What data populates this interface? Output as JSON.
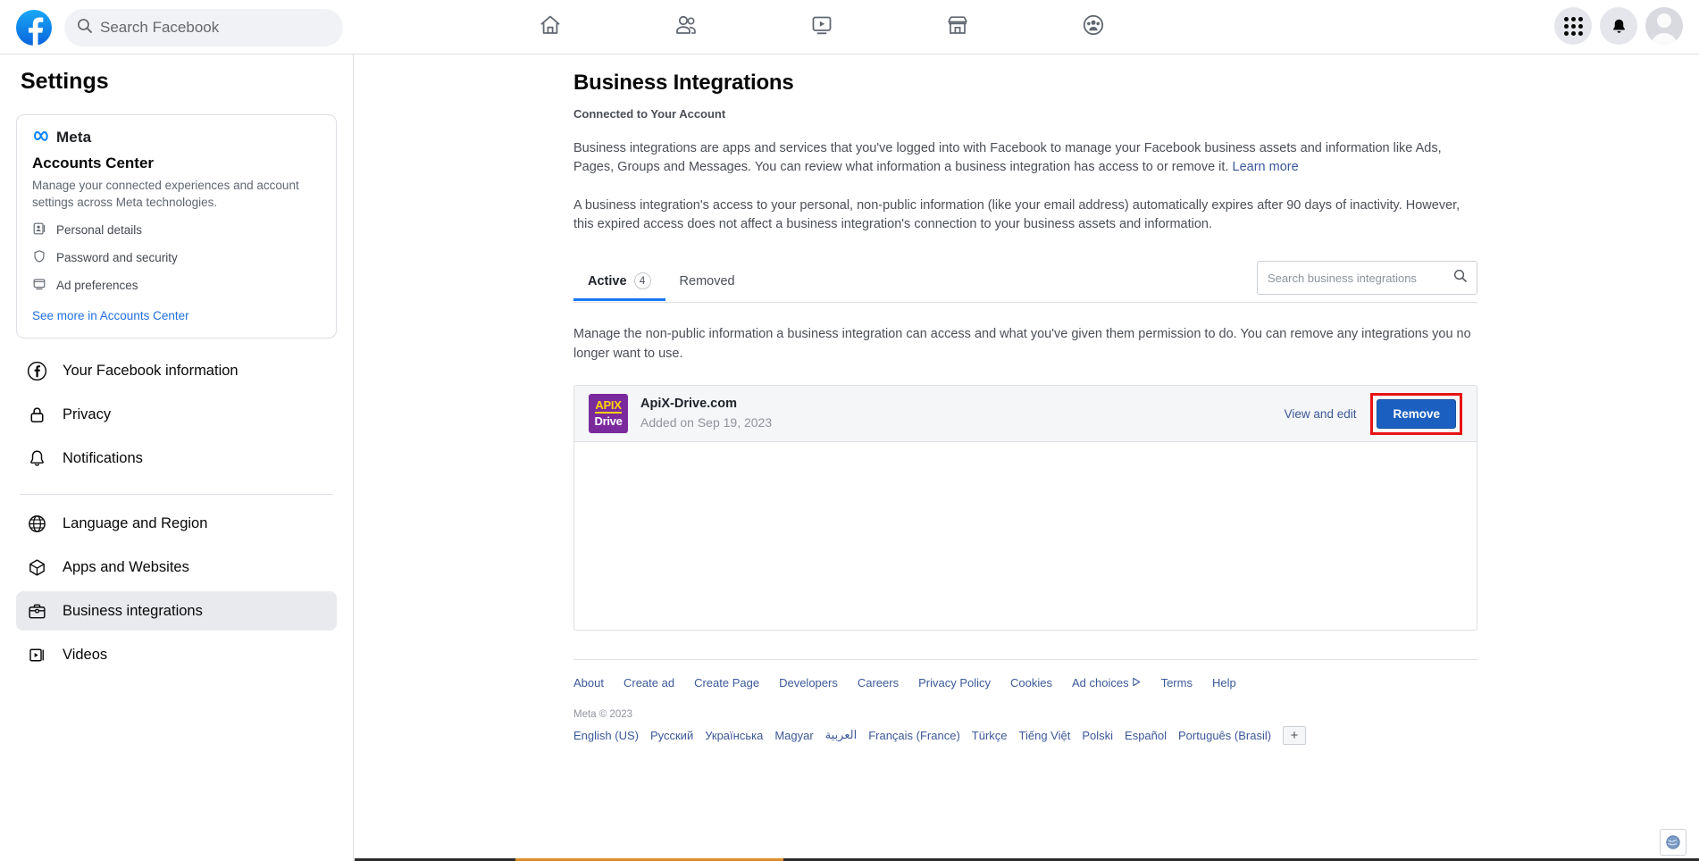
{
  "topbar": {
    "logo_icon": "facebook-logo-icon",
    "search": {
      "placeholder": "Search Facebook",
      "icon": "search-icon"
    },
    "nav": [
      {
        "name": "home",
        "icon": "home-icon"
      },
      {
        "name": "friends",
        "icon": "friends-icon"
      },
      {
        "name": "watch",
        "icon": "watch-video-icon"
      },
      {
        "name": "marketplace",
        "icon": "marketplace-storefront-icon"
      },
      {
        "name": "groups",
        "icon": "groups-icon"
      }
    ],
    "right": [
      {
        "name": "menu-grid",
        "icon": "grid-menu-icon"
      },
      {
        "name": "notifications",
        "icon": "bell-icon"
      },
      {
        "name": "profile",
        "icon": "avatar-icon"
      }
    ]
  },
  "sidebar": {
    "title": "Settings",
    "accounts_center": {
      "brand": "Meta",
      "heading": "Accounts Center",
      "description": "Manage your connected experiences and account settings across Meta technologies.",
      "links": [
        {
          "label": "Personal details",
          "icon": "id-card-icon"
        },
        {
          "label": "Password and security",
          "icon": "shield-icon"
        },
        {
          "label": "Ad preferences",
          "icon": "monitor-icon"
        }
      ],
      "see_more": "See more in Accounts Center"
    },
    "items": [
      {
        "label": "Your Facebook information",
        "icon": "facebook-circle-icon",
        "active": false
      },
      {
        "label": "Privacy",
        "icon": "lock-icon",
        "active": false
      },
      {
        "label": "Notifications",
        "icon": "bell-outline-icon",
        "active": false
      },
      {
        "label": "Language and Region",
        "icon": "globe-icon",
        "active": false
      },
      {
        "label": "Apps and Websites",
        "icon": "cube-icon",
        "active": false
      },
      {
        "label": "Business integrations",
        "icon": "briefcase-icon",
        "active": true
      },
      {
        "label": "Videos",
        "icon": "video-play-icon",
        "active": false
      }
    ]
  },
  "main": {
    "title": "Business Integrations",
    "subtitle": "Connected to Your Account",
    "paragraph1": "Business integrations are apps and services that you've logged into with Facebook to manage your Facebook business assets and information like Ads, Pages, Groups and Messages. You can review what information a business integration has access to or remove it.",
    "learn_more": "Learn more",
    "paragraph2": "A business integration's access to your personal, non-public information (like your email address) automatically expires after 90 days of inactivity. However, this expired access does not affect a business integration's connection to your business assets and information.",
    "tabs": [
      {
        "label": "Active",
        "count": "4",
        "selected": true
      },
      {
        "label": "Removed",
        "count": "",
        "selected": false
      }
    ],
    "search": {
      "placeholder": "Search business integrations",
      "icon": "search-icon"
    },
    "manage_note": "Manage the non-public information a business integration can access and what you've given them permission to do. You can remove any integrations you no longer want to use.",
    "integrations": [
      {
        "name": "ApiX-Drive.com",
        "added": "Added on Sep 19, 2023",
        "logo_line1": "APIX",
        "logo_line2": "Drive",
        "logo_bg": "#7b2a9e",
        "view_edit": "View and edit",
        "remove": "Remove",
        "highlight_color": "#e81212"
      }
    ]
  },
  "footer": {
    "links": [
      {
        "label": "About",
        "badge": false
      },
      {
        "label": "Create ad",
        "badge": false
      },
      {
        "label": "Create Page",
        "badge": false
      },
      {
        "label": "Developers",
        "badge": false
      },
      {
        "label": "Careers",
        "badge": false
      },
      {
        "label": "Privacy Policy",
        "badge": false
      },
      {
        "label": "Cookies",
        "badge": false
      },
      {
        "label": "Ad choices",
        "badge": true
      },
      {
        "label": "Terms",
        "badge": false
      },
      {
        "label": "Help",
        "badge": false
      }
    ],
    "copyright": "Meta © 2023",
    "languages": [
      "English (US)",
      "Русский",
      "Українська",
      "Magyar",
      "العربية",
      "Français (France)",
      "Türkçe",
      "Tiếng Việt",
      "Polski",
      "Español",
      "Português (Brasil)"
    ],
    "more_languages": "+"
  },
  "widget": {
    "icon": "globe-icon"
  },
  "colors": {
    "accent": "#1877f2",
    "link": "#3b5998",
    "highlight": "#e81212",
    "logo_purple": "#7b2a9e"
  }
}
